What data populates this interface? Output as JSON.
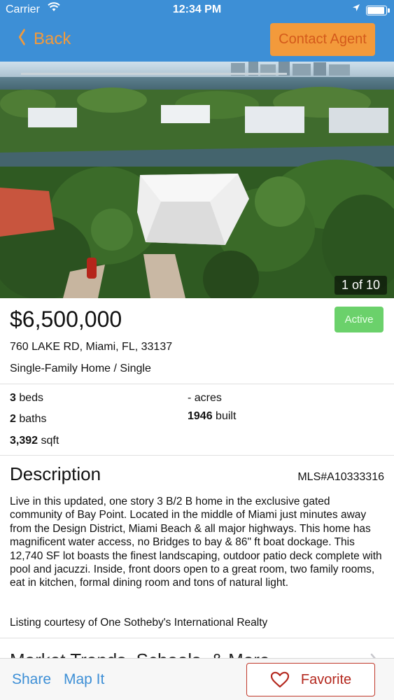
{
  "status_bar": {
    "carrier": "Carrier",
    "time": "12:34 PM"
  },
  "nav": {
    "back_label": "Back",
    "contact_label": "Contact Agent"
  },
  "gallery": {
    "counter": "1 of 10"
  },
  "listing": {
    "price": "$6,500,000",
    "status": "Active",
    "address": "760 LAKE RD, Miami, FL, 33137",
    "property_type": "Single-Family Home / Single"
  },
  "facts": {
    "beds_value": "3",
    "beds_unit": "beds",
    "baths_value": "2",
    "baths_unit": "baths",
    "sqft_value": "3,392",
    "sqft_unit": "sqft",
    "acres_text": "- acres",
    "built_value": "1946",
    "built_unit": "built"
  },
  "description": {
    "title": "Description",
    "mls": "MLS#A10333316",
    "text": "Live in this updated, one story 3 B/2 B home in the exclusive gated community of Bay Point. Located in the middle of Miami just minutes away from the Design District, Miami Beach & all major highways. This home has magnificent water access, no Bridges to bay & 86\" ft boat dockage.  This 12,740 SF lot boasts the finest landscaping, outdoor patio deck complete with pool and jacuzzi. Inside, front doors open to a great room, two family rooms, eat in kitchen, formal dining room and tons of natural light.",
    "courtesy": "Listing courtesy of One Sotheby's International Realty"
  },
  "more": {
    "label": "Market Trends, Schools, & More"
  },
  "toolbar": {
    "share_label": "Share",
    "map_label": "Map It",
    "favorite_label": "Favorite"
  },
  "colors": {
    "nav_blue": "#3d8fd6",
    "accent_orange": "#f39a3b",
    "status_green": "#6bd16b",
    "favorite_red": "#c0392b"
  },
  "icons": [
    "wifi-icon",
    "location-arrow-icon",
    "battery-icon",
    "chevron-left-icon",
    "chevron-right-icon",
    "heart-outline-icon"
  ]
}
